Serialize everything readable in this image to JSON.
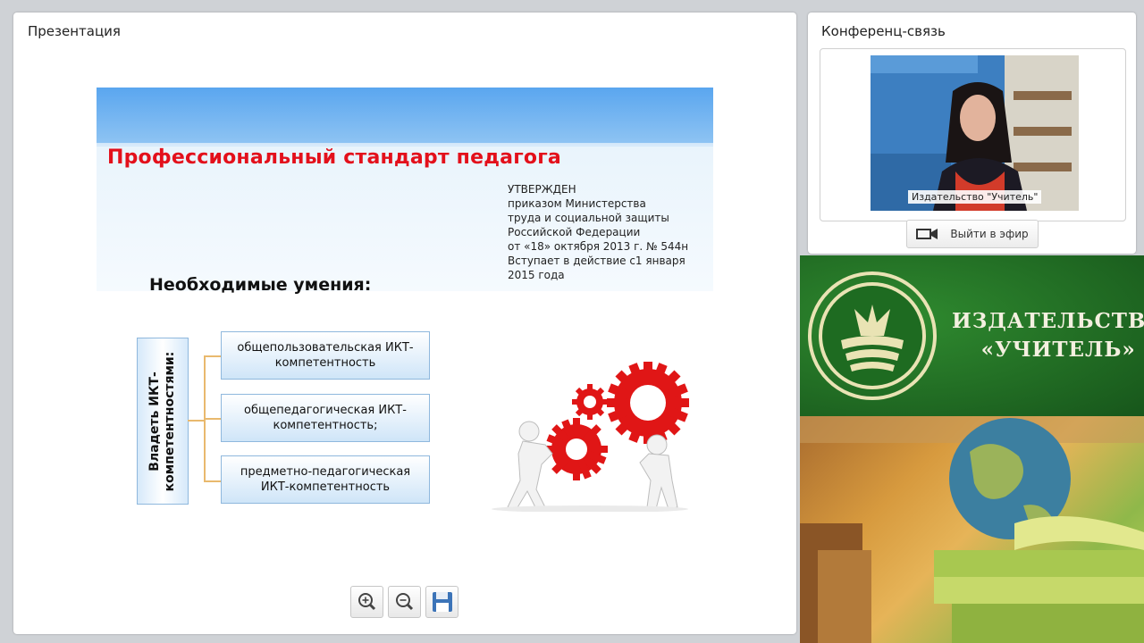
{
  "presentation": {
    "title": "Презентация",
    "slide": {
      "title": "Профессиональный стандарт педагога",
      "approved_lines": [
        "УТВЕРЖДЕН",
        "приказом Министерства",
        "труда и социальной защиты",
        "Российской Федерации",
        "от «18» октября 2013 г. № 544н",
        "Вступает в действие с1 января",
        "2015 года"
      ],
      "skills_title": "Необходимые умения:",
      "vertical_label_lines": [
        "Владеть ИКТ-",
        "компетентностями:"
      ],
      "items": [
        {
          "line1": "общепользовательская  ИКТ-",
          "line2": "компетентность"
        },
        {
          "line1": "общепедагогическая  ИКТ-",
          "line2": "компетентность;"
        },
        {
          "line1": "предметно-педагогическая",
          "line2": "ИКТ-компетентность"
        }
      ]
    },
    "toolbar": {
      "zoom_in_icon": "zoom-in-icon",
      "zoom_out_icon": "zoom-out-icon",
      "save_icon": "floppy-disk-icon"
    }
  },
  "conference": {
    "title": "Конференц-связь",
    "video_label": "Издательство \"Учитель\"",
    "go_live_label": "Выйти в эфир"
  },
  "banner": {
    "line1": "ИЗДАТЕЛЬСТВО",
    "line2": "«УЧИТЕЛЬ»"
  },
  "colors": {
    "slide_title": "#e3101b",
    "banner_green": "#1f6b22",
    "gear_red": "#e01616"
  }
}
